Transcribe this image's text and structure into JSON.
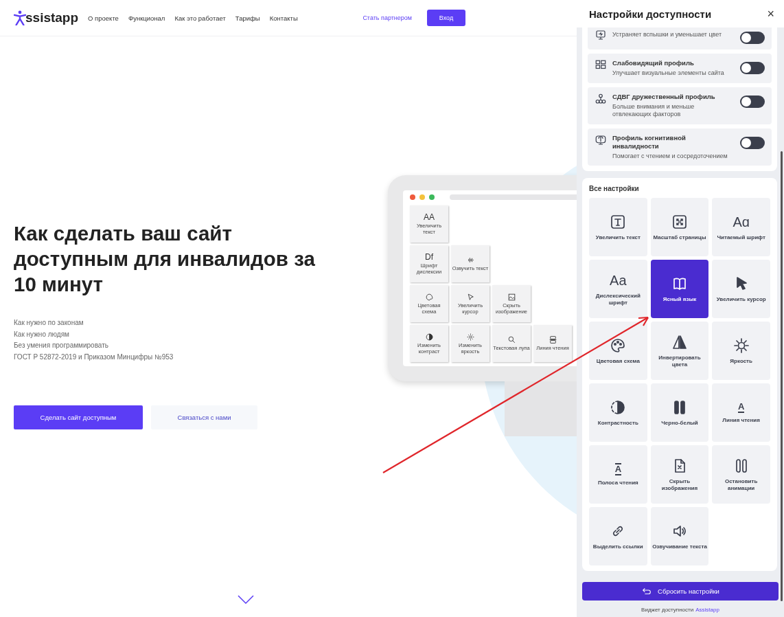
{
  "nav": {
    "logo": "ssistapp",
    "links": [
      "О проекте",
      "Функционал",
      "Как это работает",
      "Тарифы",
      "Контакты"
    ],
    "partner": "Стать партнером",
    "login": "Вход"
  },
  "hero": {
    "title": "Как сделать ваш сайт доступным для инвалидов за 10 минут",
    "points": [
      "Как нужно по законам",
      "Как нужно людям",
      "Без умения программировать",
      "ГОСТ Р 52872-2019 и Приказом Минцифры №953"
    ],
    "primary_button": "Сделать сайт доступным",
    "secondary_button": "Связаться с нами"
  },
  "illustration": {
    "tiles": [
      {
        "label": "Увеличить текст",
        "glyph": "AA"
      },
      {
        "label": "Шрифт дислексии",
        "glyph": "Df"
      },
      {
        "label": "Озвучить текст"
      },
      {
        "label": "Цветовая схема"
      },
      {
        "label": "Увеличить курсор"
      },
      {
        "label": "Скрыть изображение"
      },
      {
        "label": "Изменить контраст"
      },
      {
        "label": "Изменить яркость"
      },
      {
        "label": "Текстовая лупа"
      },
      {
        "label": "Линия чтения"
      }
    ]
  },
  "panel": {
    "title": "Настройки доступности",
    "close": "×",
    "profiles": [
      {
        "description": "Устраняет вспышки и уменьшает цвет",
        "on": false
      },
      {
        "title": "Слабовидящий профиль",
        "description": "Улучшает визуальные элементы сайта",
        "on": false
      },
      {
        "title": "СДВГ дружественный профиль",
        "description": "Больше внимания и меньше отвлекающих факторов",
        "on": false
      },
      {
        "title": "Профиль когнитивной инвалидности",
        "description": "Помогает с чтением и сосредоточением",
        "on": false
      }
    ],
    "settings_title": "Все настройки",
    "settings": [
      {
        "label": "Увеличить текст",
        "selected": false
      },
      {
        "label": "Масштаб страницы",
        "selected": false
      },
      {
        "label": "Читаемый шрифт",
        "glyph": "Aɑ",
        "selected": false
      },
      {
        "label": "Дислексический шрифт",
        "glyph": "Aa",
        "selected": false
      },
      {
        "label": "Ясный язык",
        "selected": true
      },
      {
        "label": "Увеличить курсор",
        "selected": false
      },
      {
        "label": "Цветовая схема",
        "selected": false
      },
      {
        "label": "Инвертировать цвета",
        "selected": false
      },
      {
        "label": "Яркость",
        "selected": false
      },
      {
        "label": "Контрастность",
        "selected": false
      },
      {
        "label": "Черно-белый",
        "selected": false
      },
      {
        "label": "Линия чтения",
        "glyph": "A",
        "selected": false
      },
      {
        "label": "Полоса чтения",
        "glyph": "A",
        "selected": false
      },
      {
        "label": "Скрыть изображения",
        "selected": false
      },
      {
        "label": "Остановить анимации",
        "selected": false
      },
      {
        "label": "Выделить ссылки",
        "selected": false
      },
      {
        "label": "Озвучивание текста",
        "selected": false
      }
    ],
    "reset": "Сбросить настройки",
    "footer": {
      "text": "Виджет доступности",
      "link": "Assistapp"
    }
  }
}
